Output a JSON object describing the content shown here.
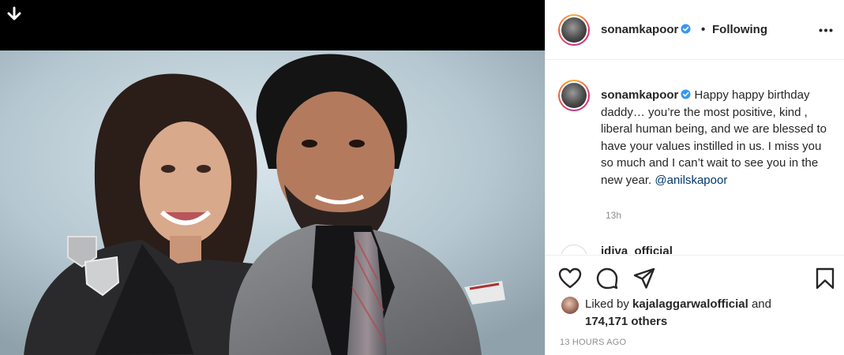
{
  "post": {
    "author": "sonamkapoor",
    "follow_separator": "•",
    "follow_status": "Following",
    "caption_text": "Happy happy birthday daddy… you’re the most positive, kind , liberal human being, and we are blessed to have your values instilled in us. I miss you so much and I can’t wait to see you in the new year.",
    "caption_mention": "@anilskapoor",
    "caption_time": "13h",
    "next_comment_author": "idiva_official",
    "liked_by_prefix": "Liked by",
    "liked_by_user": "kajalaggarwalofficial",
    "liked_by_and": "and",
    "likes_count": "174,171 others",
    "timestamp": "13 HOURS AGO"
  },
  "icons": {
    "download": "download-icon",
    "verified": "verified-badge-icon",
    "more": "more-options-icon",
    "like": "heart-icon",
    "comment": "comment-icon",
    "share": "share-icon",
    "save": "bookmark-icon"
  },
  "colors": {
    "verified_blue": "#3897f0",
    "mention_blue": "#00376b",
    "muted_gray": "#8e8e8e",
    "text": "#262626",
    "divider": "#efefef"
  }
}
